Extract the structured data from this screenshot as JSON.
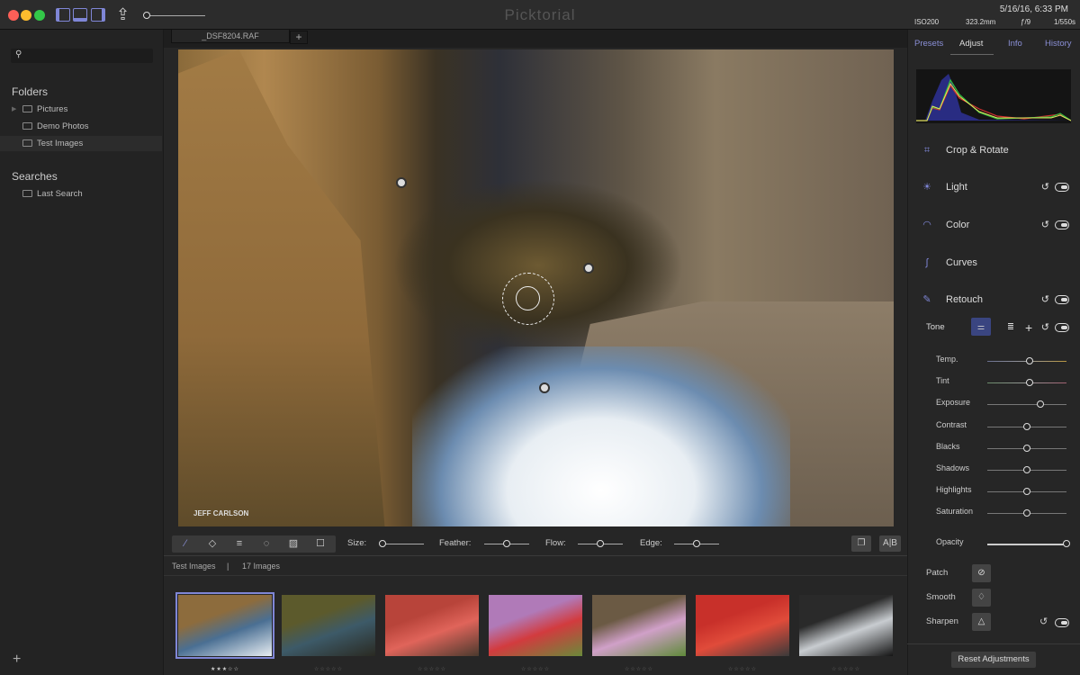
{
  "window": {
    "title": "Picktorial",
    "traffic_colors": [
      "#fc5f57",
      "#fdbc2e",
      "#33c748"
    ]
  },
  "tabs": {
    "active": "_DSF8204.RAF",
    "add": "+"
  },
  "exif": {
    "datetime": "5/16/16, 6:33 PM",
    "iso": "ISO200",
    "focal": "323.2mm",
    "aperture": "ƒ/9",
    "shutter": "1/550s"
  },
  "sidebar": {
    "search_placeholder": "",
    "folders_title": "Folders",
    "folders": [
      {
        "label": "Pictures"
      },
      {
        "label": "Demo Photos"
      },
      {
        "label": "Test Images"
      }
    ],
    "searches_title": "Searches",
    "searches": [
      {
        "label": "Last Search"
      }
    ],
    "add": "+"
  },
  "photo": {
    "watermark": "JEFF CARLSON"
  },
  "brush_toolbar": {
    "size_label": "Size:",
    "feather_label": "Feather:",
    "flow_label": "Flow:",
    "edge_label": "Edge:",
    "size": 0,
    "feather": 0.5,
    "flow": 0.5,
    "edge": 0.5,
    "ab_label": "A|B"
  },
  "filmstrip": {
    "folder": "Test Images",
    "sep": "|",
    "count": "17 Images",
    "thumbs": [
      {
        "rating": 3,
        "stars": "★★★☆☆",
        "selected": true,
        "colors": [
          "#8d6c3d",
          "#4a6f93",
          "#e8eef3"
        ]
      },
      {
        "rating": 0,
        "stars": "☆☆☆☆☆",
        "colors": [
          "#5c5a2c",
          "#3d5a68",
          "#2a2a22"
        ]
      },
      {
        "rating": 0,
        "stars": "☆☆☆☆☆",
        "colors": [
          "#b8443a",
          "#e0645a",
          "#4a3a2e"
        ]
      },
      {
        "rating": 0,
        "stars": "☆☆☆☆☆",
        "colors": [
          "#b07ab8",
          "#d23b3e",
          "#6a8a3a"
        ]
      },
      {
        "rating": 0,
        "stars": "☆☆☆☆☆",
        "colors": [
          "#6b5a44",
          "#d0a0c8",
          "#5f8a3a"
        ]
      },
      {
        "rating": 0,
        "stars": "☆☆☆☆☆",
        "colors": [
          "#c8302a",
          "#e04b3a",
          "#3a3a3a"
        ]
      },
      {
        "rating": 0,
        "stars": "☆☆☆☆☆",
        "colors": [
          "#2a2a2a",
          "#c8ccd0",
          "#151515"
        ]
      }
    ]
  },
  "panel": {
    "tabs": [
      "Presets",
      "Adjust",
      "Info",
      "History"
    ],
    "active_tab": "Adjust",
    "sections": [
      {
        "label": "Crop & Rotate",
        "icon": "crop-icon"
      },
      {
        "label": "Light",
        "icon": "bulb-icon"
      },
      {
        "label": "Color",
        "icon": "rainbow-icon"
      },
      {
        "label": "Curves",
        "icon": "curve-icon"
      },
      {
        "label": "Retouch",
        "icon": "brush-icon"
      }
    ],
    "tone_label": "Tone",
    "sliders": [
      {
        "label": "Temp.",
        "value": 0.53
      },
      {
        "label": "Tint",
        "value": 0.53
      },
      {
        "label": "Exposure",
        "value": 0.67
      },
      {
        "label": "Contrast",
        "value": 0.5
      },
      {
        "label": "Blacks",
        "value": 0.5
      },
      {
        "label": "Shadows",
        "value": 0.5
      },
      {
        "label": "Highlights",
        "value": 0.5
      },
      {
        "label": "Saturation",
        "value": 0.5
      }
    ],
    "opacity": {
      "label": "Opacity",
      "value": 1.0
    },
    "tools": [
      {
        "label": "Patch",
        "icon": "bandage-icon"
      },
      {
        "label": "Smooth",
        "icon": "drop-icon"
      },
      {
        "label": "Sharpen",
        "icon": "triangle-icon"
      }
    ],
    "reset_label": "Reset Adjustments"
  }
}
